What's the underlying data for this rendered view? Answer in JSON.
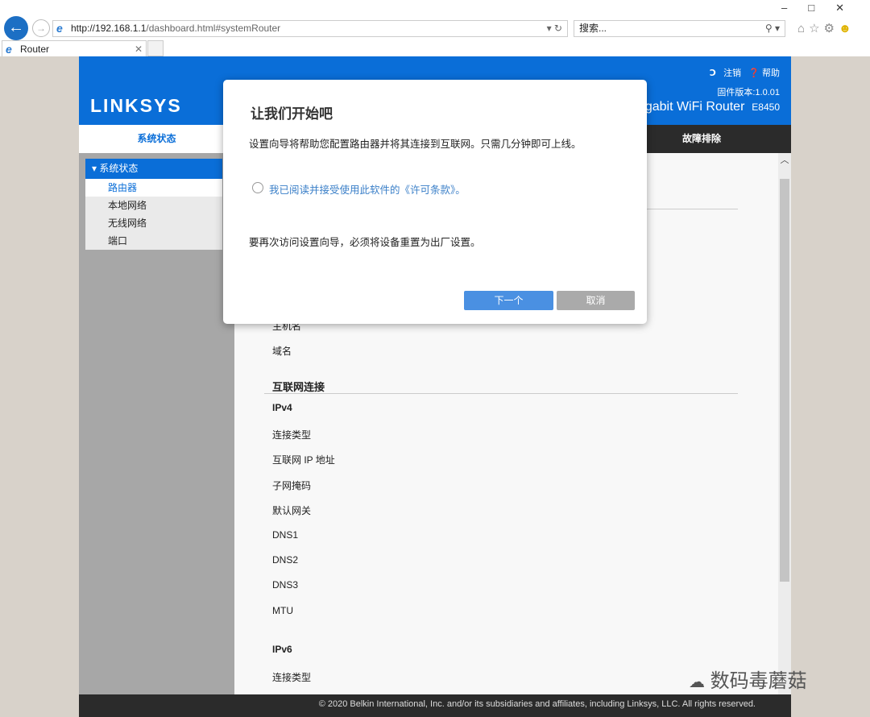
{
  "browser": {
    "url_host": "http://192.168.1.1",
    "url_path": "/dashboard.html#systemRouter",
    "search_placeholder": "搜索...",
    "tab_title": "Router",
    "window_controls": [
      "minimize",
      "maximize",
      "close"
    ]
  },
  "header": {
    "logo": "LINKSYS",
    "logout": "注销",
    "help": "帮助",
    "firmware": "固件版本:1.0.01",
    "product": "gabit WiFi Router",
    "model": "E8450",
    "color": "#0a6ed8"
  },
  "nav": {
    "active": "系统状态",
    "right": "故障排除"
  },
  "sidebar": {
    "header": "系统状态",
    "items": [
      {
        "label": "路由器",
        "selected": true
      },
      {
        "label": "本地网络"
      },
      {
        "label": "无线网络"
      },
      {
        "label": "端口"
      }
    ]
  },
  "content": {
    "rows_top": [
      "主机名",
      "域名"
    ],
    "internet_heading": "互联网连接",
    "ipv4": "IPv4",
    "ipv4_rows": [
      "连接类型",
      "互联网 IP 地址",
      "子网掩码",
      "默认网关",
      "DNS1",
      "DNS2",
      "DNS3",
      "MTU"
    ],
    "ipv6": "IPv6",
    "ipv6_rows": [
      "连接类型"
    ]
  },
  "modal": {
    "title": "让我们开始吧",
    "intro": "设置向导将帮助您配置路由器并将其连接到互联网。只需几分钟即可上线。",
    "agree": "我已阅读并接受使用此软件的《许可条款》。",
    "note": "要再次访问设置向导，必须将设备重置为出厂设置。",
    "next": "下一个",
    "cancel": "取消"
  },
  "footer": "© 2020 Belkin International, Inc. and/or its subsidiaries and affiliates, including Linksys, LLC. All rights reserved.",
  "watermark": "数码毒蘑菇"
}
